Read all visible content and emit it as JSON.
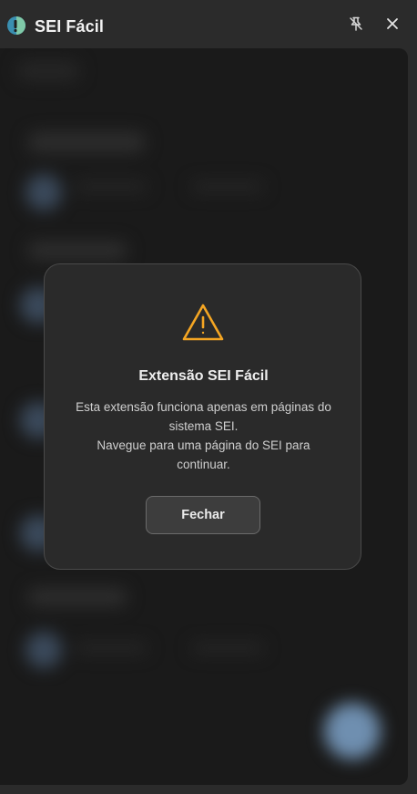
{
  "window": {
    "title": "SEI Fácil",
    "icons": {
      "app": "sei-facil-logo-icon",
      "pin": "unpin-icon",
      "close": "close-icon"
    }
  },
  "dialog": {
    "icon": "warning-icon",
    "title": "Extensão SEI Fácil",
    "message_lines": [
      "Esta extensão funciona apenas em páginas do",
      "sistema SEI.",
      "Navegue para uma página do SEI para",
      "continuar."
    ],
    "close_label": "Fechar"
  },
  "colors": {
    "warning": "#f5a623",
    "background": "#1a1a1a",
    "titlebar": "#2b2b2b",
    "dialog": "#2a2a2a"
  }
}
